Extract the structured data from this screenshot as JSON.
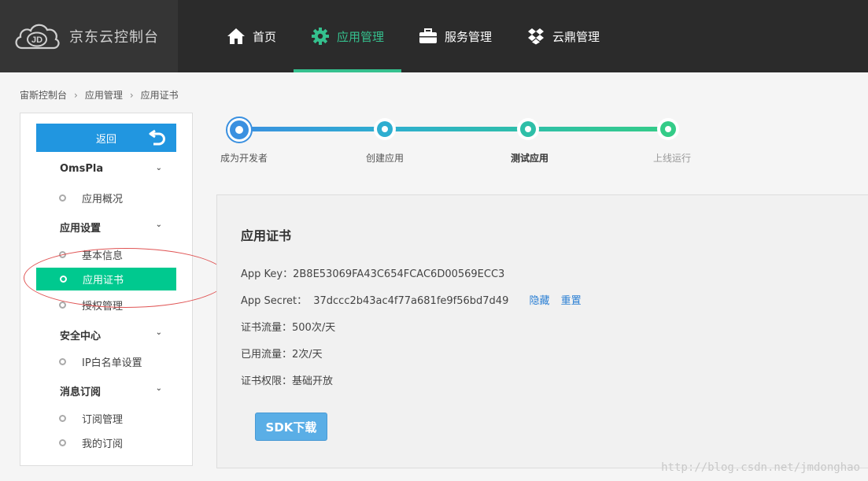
{
  "header": {
    "logo_text": "京东云控制台",
    "nav": [
      {
        "label": "首页",
        "icon": "home-icon",
        "active": false
      },
      {
        "label": "应用管理",
        "icon": "gear-icon",
        "active": true
      },
      {
        "label": "服务管理",
        "icon": "briefcase-icon",
        "active": false
      },
      {
        "label": "云鼎管理",
        "icon": "dropbox-icon",
        "active": false
      }
    ],
    "accent_color": "#35c08e"
  },
  "breadcrumb": [
    "宙斯控制台",
    "应用管理",
    "应用证书"
  ],
  "sidebar": {
    "back_label": "返回",
    "groups": [
      {
        "label": "OmsPla",
        "items": [
          {
            "label": "应用概况"
          }
        ]
      },
      {
        "label": "应用设置",
        "items": [
          {
            "label": "基本信息"
          },
          {
            "label": "应用证书",
            "active": true
          },
          {
            "label": "授权管理"
          }
        ]
      },
      {
        "label": "安全中心",
        "items": [
          {
            "label": "IP白名单设置"
          }
        ]
      },
      {
        "label": "消息订阅",
        "items": [
          {
            "label": "订阅管理"
          },
          {
            "label": "我的订阅"
          }
        ]
      }
    ]
  },
  "steps": [
    {
      "label": "成为开发者",
      "current": true
    },
    {
      "label": "创建应用"
    },
    {
      "label": "测试应用",
      "bold": true
    },
    {
      "label": "上线运行",
      "muted": true
    }
  ],
  "panel": {
    "title": "应用证书",
    "app_key_label": "App Key：",
    "app_key": "2B8E53069FA43C654FCAC6D00569ECC3",
    "app_secret_label": "App Secret：",
    "app_secret": "37dccc2b43ac4f77a681fe9f56bd7d49",
    "hide_link": "隐藏",
    "reset_link": "重置",
    "cert_flow_label": "证书流量：",
    "cert_flow": "500次/天",
    "used_flow_label": "已用流量：",
    "used_flow": "2次/天",
    "cert_permission_label": "证书权限：",
    "cert_permission": "基础开放",
    "sdk_button": "SDK下载"
  },
  "watermark": "http://blog.csdn.net/jmdonghao"
}
